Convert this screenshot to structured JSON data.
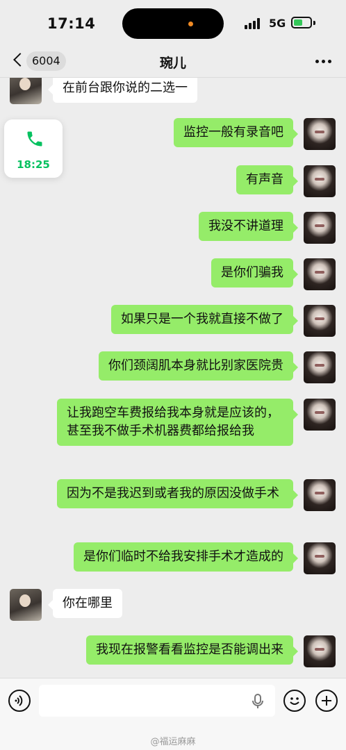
{
  "status_bar": {
    "time": "17:14",
    "network": "5G"
  },
  "nav": {
    "back_count": "6004",
    "title": "琬儿"
  },
  "call_widget": {
    "duration": "18:25"
  },
  "messages": [
    {
      "side": "in",
      "text": "在前台跟你说的二选一"
    },
    {
      "side": "out",
      "text": "监控一般有录音吧"
    },
    {
      "side": "out",
      "text": "有声音"
    },
    {
      "side": "out",
      "text": "我没不讲道理"
    },
    {
      "side": "out",
      "text": "是你们骗我"
    },
    {
      "side": "out",
      "text": "如果只是一个我就直接不做了"
    },
    {
      "side": "out",
      "text": "你们颈阔肌本身就比别家医院贵"
    },
    {
      "side": "out",
      "text": "让我跑空车费报给我本身就是应该的，甚至我不做手术机器费都给报给我"
    },
    {
      "side": "out",
      "text": "因为不是我迟到或者我的原因没做手术"
    },
    {
      "side": "out",
      "text": "是你们临时不给我安排手术才造成的"
    },
    {
      "side": "in",
      "text": "你在哪里"
    },
    {
      "side": "out",
      "text": "我现在报警看看监控是否能调出来"
    }
  ],
  "watermark": "@福运麻麻",
  "colors": {
    "outgoing_bubble": "#95ec69",
    "incoming_bubble": "#ffffff",
    "accent_green": "#07c160",
    "background": "#ededed"
  },
  "icons": [
    "back-arrow-icon",
    "more-icon",
    "phone-icon",
    "voice-icon",
    "mic-icon",
    "emoji-icon",
    "plus-icon"
  ]
}
